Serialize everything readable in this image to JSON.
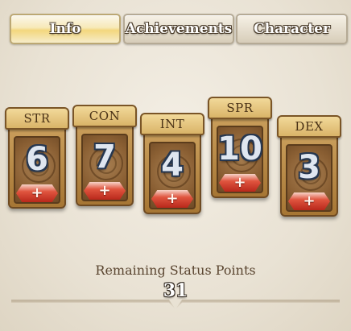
{
  "tabs": [
    {
      "label": "Info",
      "active": true
    },
    {
      "label": "Achievements",
      "active": false
    },
    {
      "label": "Character",
      "active": false
    }
  ],
  "stats": [
    {
      "name": "STR",
      "value": "6",
      "plus_icon": "+"
    },
    {
      "name": "CON",
      "value": "7",
      "plus_icon": "+"
    },
    {
      "name": "INT",
      "value": "4",
      "plus_icon": "+"
    },
    {
      "name": "SPR",
      "value": "10",
      "plus_icon": "+"
    },
    {
      "name": "DEX",
      "value": "3",
      "plus_icon": "+"
    }
  ],
  "remaining": {
    "label": "Remaining Status Points",
    "value": "31"
  },
  "colors": {
    "accent_tab": "#f3d77d",
    "plus_button": "#e0553f",
    "card_wood": "#a67634"
  }
}
